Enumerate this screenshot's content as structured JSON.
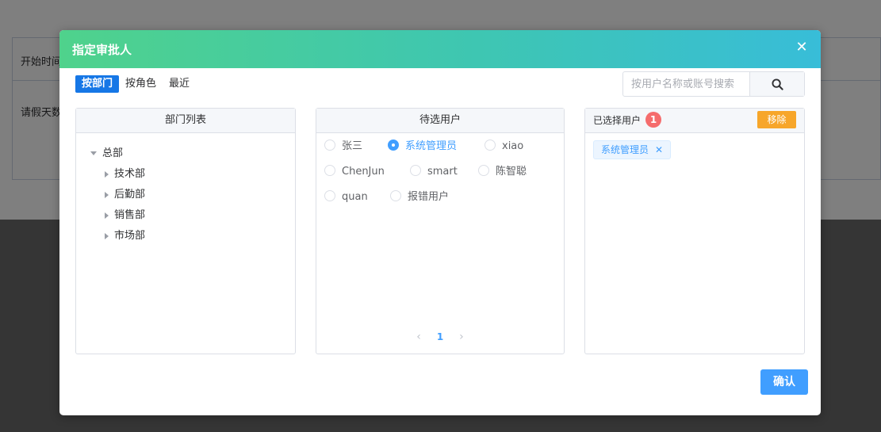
{
  "background": {
    "rows": [
      {
        "label": "开始时间"
      },
      {
        "label": "请假天数"
      }
    ]
  },
  "dialog": {
    "title": "指定审批人",
    "tabs": [
      {
        "label": "按部门",
        "active": true
      },
      {
        "label": "按角色",
        "active": false
      },
      {
        "label": "最近",
        "active": false
      }
    ],
    "search": {
      "placeholder": "按用户名称或账号搜索"
    },
    "dept_panel": {
      "title": "部门列表",
      "root": "总部",
      "children": [
        "技术部",
        "后勤部",
        "销售部",
        "市场部"
      ]
    },
    "candidate_panel": {
      "title": "待选用户",
      "users": [
        {
          "name": "张三",
          "checked": false
        },
        {
          "name": "系统管理员",
          "checked": true
        },
        {
          "name": "xiao",
          "checked": false
        },
        {
          "name": "ChenJun",
          "checked": false
        },
        {
          "name": "smart",
          "checked": false
        },
        {
          "name": "陈智聪",
          "checked": false
        },
        {
          "name": "quan",
          "checked": false
        },
        {
          "name": "报错用户",
          "checked": false
        }
      ],
      "page": "1"
    },
    "selected_panel": {
      "title": "已选择用户",
      "count": "1",
      "remove_label": "移除",
      "tags": [
        "系统管理员"
      ]
    },
    "confirm_label": "确认"
  },
  "colors": {
    "primary": "#409eff",
    "tab_active": "#1677e6",
    "badge": "#f56c6c",
    "remove": "#f7a62a",
    "header_gradient_start": "#4fd28c",
    "header_gradient_end": "#38bdd8"
  }
}
